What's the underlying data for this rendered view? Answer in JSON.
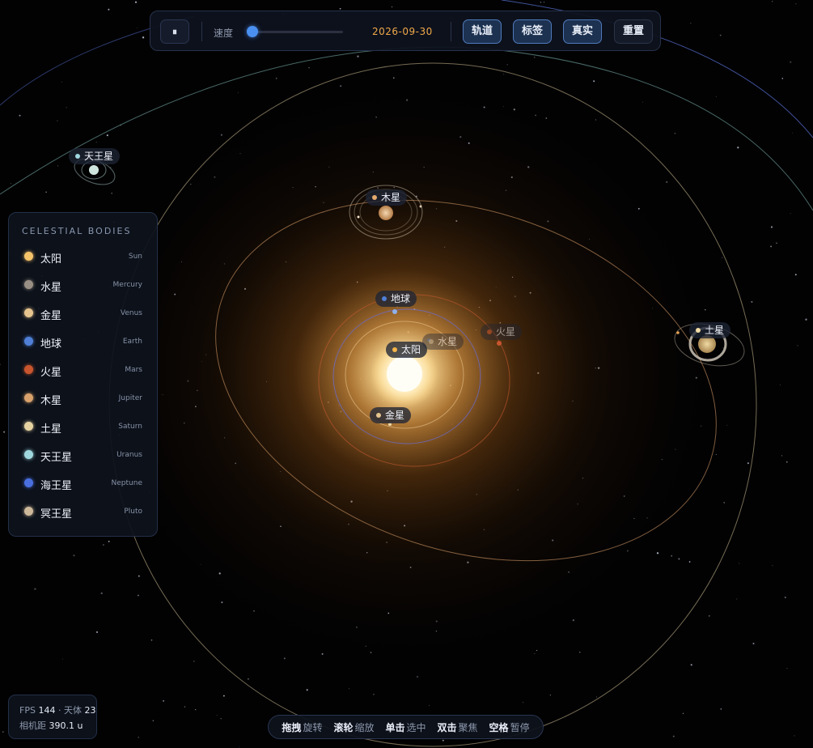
{
  "toolbar": {
    "pause_glyph": "⏸",
    "speed_label": "速度",
    "speed_value": 0.02,
    "date": "2026-09-30",
    "buttons": [
      {
        "label": "轨道",
        "active": true
      },
      {
        "label": "标签",
        "active": true
      },
      {
        "label": "真实",
        "active": true
      },
      {
        "label": "重置",
        "active": false
      }
    ]
  },
  "scene_labels": {
    "sun": "太阳",
    "mercury": "水星",
    "venus": "金星",
    "earth": "地球",
    "mars": "火星",
    "jupiter": "木星",
    "saturn": "土星",
    "uranus": "天王星"
  },
  "panel": {
    "title": "CELESTIAL BODIES",
    "bodies": [
      {
        "name": "太阳",
        "en": "Sun",
        "color": "#f5c36a"
      },
      {
        "name": "水星",
        "en": "Mercury",
        "color": "#9a8f84"
      },
      {
        "name": "金星",
        "en": "Venus",
        "color": "#e6c48e"
      },
      {
        "name": "地球",
        "en": "Earth",
        "color": "#4f7fd6"
      },
      {
        "name": "火星",
        "en": "Mars",
        "color": "#c8552e"
      },
      {
        "name": "木星",
        "en": "Jupiter",
        "color": "#d9a26c"
      },
      {
        "name": "土星",
        "en": "Saturn",
        "color": "#e7d3a2"
      },
      {
        "name": "天王星",
        "en": "Uranus",
        "color": "#9fd7de"
      },
      {
        "name": "海王星",
        "en": "Neptune",
        "color": "#4a6fe0"
      },
      {
        "name": "冥王星",
        "en": "Pluto",
        "color": "#cdb89a"
      }
    ]
  },
  "stats": {
    "fps_label": "FPS",
    "fps": "144",
    "bodies_label": "· 天体",
    "bodies_count": "23",
    "camera_label": "相机距",
    "camera_dist": "390.1 u"
  },
  "hints": [
    {
      "key": "拖拽",
      "action": "旋转"
    },
    {
      "key": "滚轮",
      "action": "缩放"
    },
    {
      "key": "单击",
      "action": "选中"
    },
    {
      "key": "双击",
      "action": "聚焦"
    },
    {
      "key": "空格",
      "action": "暂停"
    }
  ]
}
